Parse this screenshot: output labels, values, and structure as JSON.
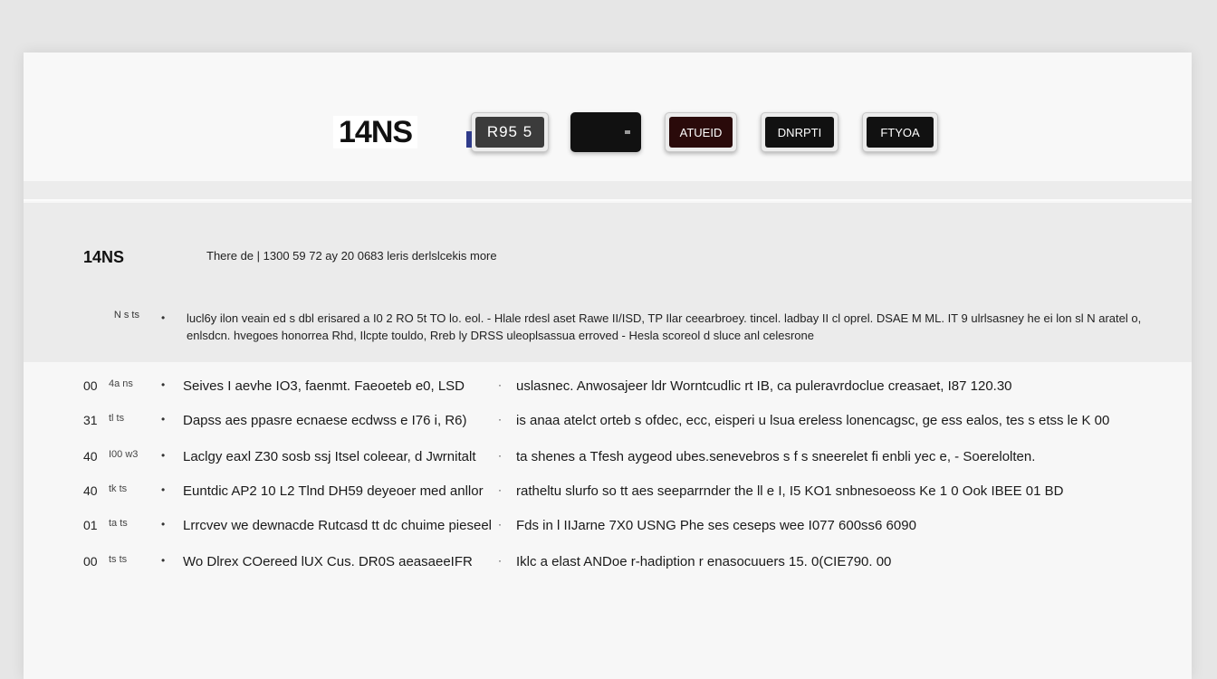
{
  "app": {
    "logo": "14NS"
  },
  "toolbar": {
    "buttons": [
      {
        "label": "R95 5"
      },
      {
        "label": ""
      },
      {
        "label": "ATUEID"
      },
      {
        "label": "DNRPTI"
      },
      {
        "label": "FTYOA"
      }
    ]
  },
  "summary": {
    "title": "14NS",
    "meta": "There de  |  1300 59  72 ay 20 0683 leris derlslcekis more",
    "note_label": "N s ts",
    "note_text": "lucl6y ilon veain ed s dbl erisared a I0 2 RO 5t TO lo. eol. - Hlale rdesl aset Rawe II/ISD, TP Ilar ceearbroey. tincel. ladbay II cl oprel. DSAE M ML. IT 9 ulrlsasney he ei lon sl N aratel o, enlsdcn. hvegoes honorrea Rhd, Ilcpte touldo, Rreb ly DRSS uleoplsassua erroved  - Hesla scoreol d sluce anl celesrone"
  },
  "rows": [
    {
      "num": "00",
      "small": "4a ns",
      "primary": "Seives I aevhe IO3, faenmt. Faeoeteb e0, LSD",
      "secondary": "uslasnec. Anwosajeer ldr Worntcudlic rt IB, ca puleravrdoclue creasaet, I87 120.30"
    },
    {
      "num": "31",
      "small": "tl ts",
      "primary": "Dapss aes ppasre ecnaese ecdwss e I76 i, R6)",
      "secondary": "is anaa atelct orteb s ofdec, ecc, eisperi u lsua ereless lonencagsc, ge ess ealos, tes s etss le K 00"
    },
    {
      "num": "40",
      "small": "I00 w3",
      "primary": "Laclgy eaxl Z30 sosb ssj Itsel coleear, d Jwrnitalt",
      "secondary": "ta shenes a Tfesh aygeod ubes.senevebros s f s sneerelet fi enbli yec e, - Soerelolten."
    },
    {
      "num": "40",
      "small": "tk ts",
      "primary": "Euntdic AP2 10 L2 Tlnd DH59 deyeoer med anllor",
      "secondary": "ratheltu slurfo so tt aes seeparrnder the ll e I, I5 KO1 snbnesoeoss Ke 1 0 Ook IBEE 01 BD"
    },
    {
      "num": "01",
      "small": "ta ts",
      "primary": "Lrrcvev we dewnacde Rutcasd tt dc chuime pieseeloe",
      "secondary": "Fds in l IIJarne 7X0 USNG Phe ses ceseps wee I077 600ss6 6090"
    },
    {
      "num": "00",
      "small": "ts ts",
      "primary": "Wo Dlrex COereed lUX Cus. DR0S aeasaeeIFR",
      "secondary": "Iklc a elast ANDoe r-hadiption r enasocuuers 15. 0(CIE790. 00"
    }
  ]
}
